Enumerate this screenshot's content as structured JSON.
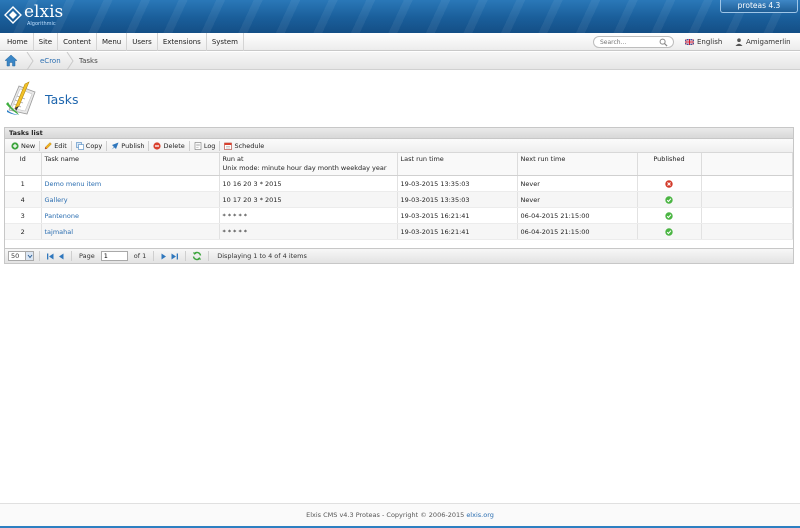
{
  "header": {
    "logo_text": "elxis",
    "logo_subtitle": "Algorithmic",
    "version_badge": "proteas 4.3",
    "colors": {
      "header_blue": "#1a5e9a",
      "link_blue": "#2a6db0"
    }
  },
  "menubar": {
    "items": [
      "Home",
      "Site",
      "Content",
      "Menu",
      "Users",
      "Extensions",
      "System"
    ],
    "search_placeholder": "Search...",
    "language": "English",
    "user": "Amigamerlin"
  },
  "breadcrumb": {
    "home_icon": "home-icon",
    "items": [
      "eCron",
      "Tasks"
    ]
  },
  "page": {
    "title": "Tasks",
    "icon": "tasks-clipboard-icon"
  },
  "grid": {
    "title": "Tasks list",
    "toolbar": [
      "New",
      "Edit",
      "Copy",
      "Publish",
      "Delete",
      "Log",
      "Schedule"
    ],
    "columns": {
      "id": "Id",
      "task_name": "Task name",
      "run_at": "Run at",
      "run_at_sub": "Unix mode: minute hour day month weekday year",
      "last_run": "Last run time",
      "next_run": "Next run time",
      "published": "Published"
    },
    "rows": [
      {
        "id": "1",
        "name": "Demo menu item",
        "run_at": "10 16 20 3 * 2015",
        "last_run": "19-03-2015 13:35:03",
        "next_run": "Never",
        "published": "unpublished"
      },
      {
        "id": "4",
        "name": "Gallery",
        "run_at": "10 17 20 3 * 2015",
        "last_run": "19-03-2015 13:35:03",
        "next_run": "Never",
        "published": "published"
      },
      {
        "id": "3",
        "name": "Pantenone",
        "run_at": "* * * * *",
        "last_run": "19-03-2015 16:21:41",
        "next_run": "06-04-2015 21:15:00",
        "published": "published"
      },
      {
        "id": "2",
        "name": "tajmahal",
        "run_at": "* * * * *",
        "last_run": "19-03-2015 16:21:41",
        "next_run": "06-04-2015 21:15:00",
        "published": "published"
      }
    ],
    "pager": {
      "rows_per_page": "50",
      "page_label": "Page",
      "page_value": "1",
      "of_label": "of 1",
      "display_text": "Displaying 1 to 4 of 4 items"
    }
  },
  "footer": {
    "text": "Elxis CMS v4.3 Proteas - Copyright © 2006-2015",
    "link": "elxis.org"
  }
}
